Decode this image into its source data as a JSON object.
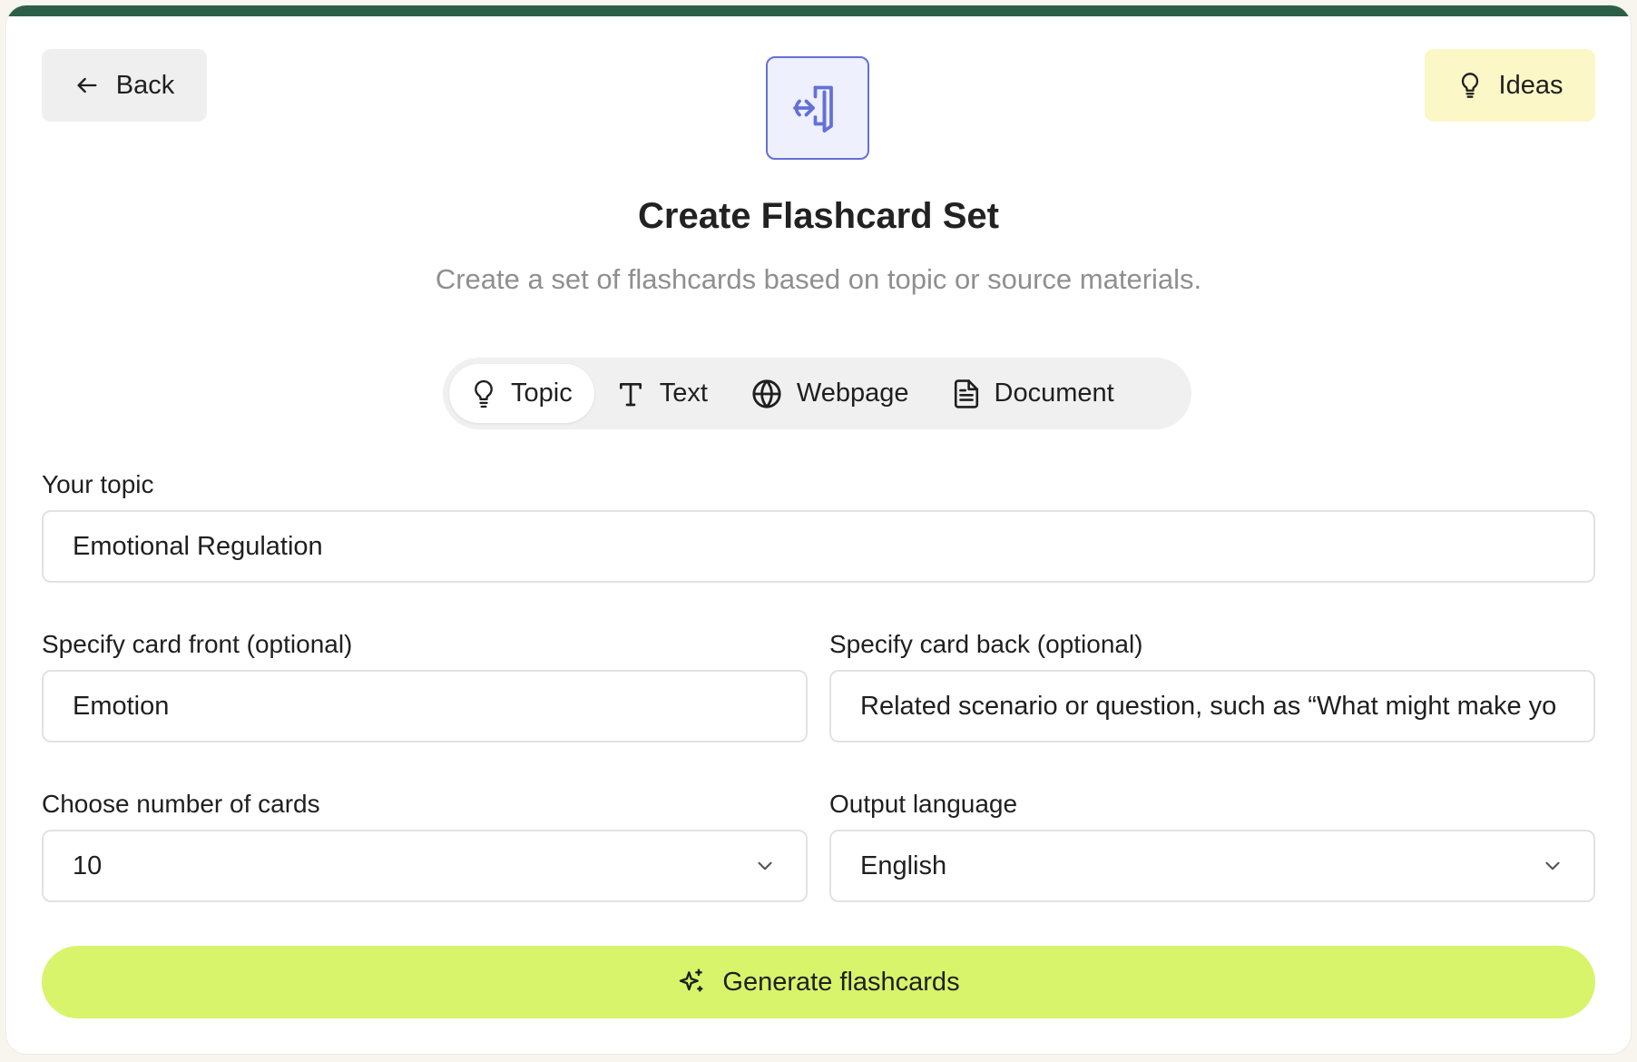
{
  "header": {
    "back_label": "Back",
    "ideas_label": "Ideas",
    "title": "Create Flashcard Set",
    "subtitle": "Create a set of flashcards based on topic or source materials."
  },
  "tabs": [
    {
      "label": "Topic",
      "icon": "lightbulb-icon",
      "active": true
    },
    {
      "label": "Text",
      "icon": "text-icon",
      "active": false
    },
    {
      "label": "Webpage",
      "icon": "globe-icon",
      "active": false
    },
    {
      "label": "Document",
      "icon": "document-icon",
      "active": false
    }
  ],
  "form": {
    "topic_label": "Your topic",
    "topic_value": "Emotional Regulation",
    "front_label": "Specify card front (optional)",
    "front_value": "Emotion",
    "back_label": "Specify card back (optional)",
    "back_value": "Related scenario or question, such as “What might make yo",
    "count_label": "Choose number of cards",
    "count_value": "10",
    "language_label": "Output language",
    "language_value": "English"
  },
  "actions": {
    "generate_label": "Generate flashcards"
  },
  "colors": {
    "topbar": "#2d5f48",
    "ideas_bg": "#fbf7c6",
    "generate_bg": "#d7f46b",
    "icon_accent": "#6470d8",
    "icon_bg": "#eef0fd"
  }
}
